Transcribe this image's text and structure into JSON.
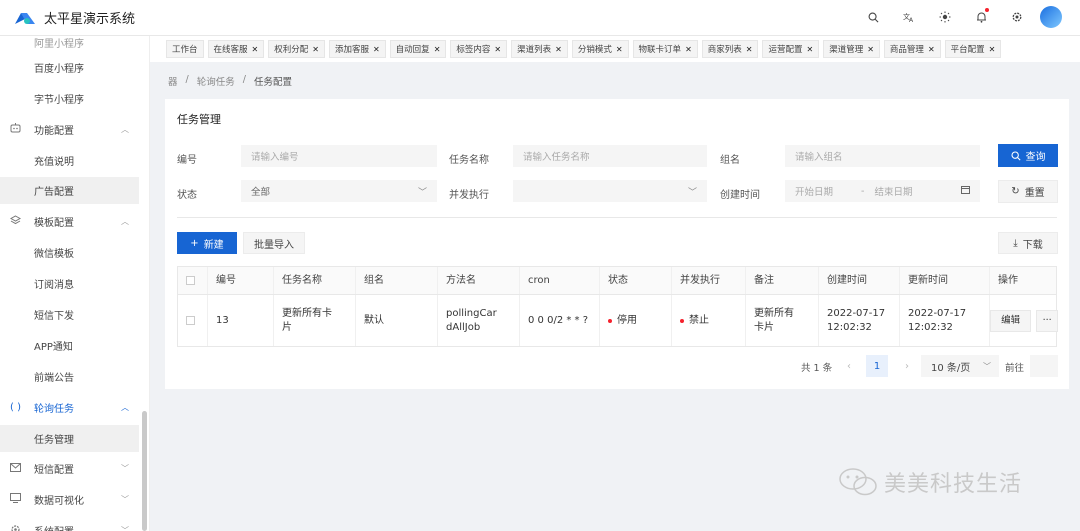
{
  "app": {
    "title": "太平星演示系统",
    "brand_color": "#1765d3"
  },
  "header": {
    "icons": [
      "search-icon",
      "translate-icon",
      "theme-sun-icon",
      "bell-icon",
      "settings-gear-icon",
      "avatar"
    ]
  },
  "sidebar": {
    "items": [
      {
        "label": "百度小程序",
        "type": "sub"
      },
      {
        "label": "字节小程序",
        "type": "sub"
      },
      {
        "label": "功能配置",
        "type": "group",
        "icon": "robot-icon"
      },
      {
        "label": "充值说明",
        "type": "sub"
      },
      {
        "label": "广告配置",
        "type": "sub",
        "active": true
      },
      {
        "label": "模板配置",
        "type": "group",
        "icon": "layers-icon"
      },
      {
        "label": "微信模板",
        "type": "sub"
      },
      {
        "label": "订阅消息",
        "type": "sub"
      },
      {
        "label": "短信下发",
        "type": "sub"
      },
      {
        "label": "APP通知",
        "type": "sub"
      },
      {
        "label": "前端公告",
        "type": "sub"
      },
      {
        "label": "轮询任务",
        "type": "group",
        "icon": "code-braces-icon",
        "open": true
      },
      {
        "label": "任务管理",
        "type": "sub",
        "active": true
      },
      {
        "label": "短信配置",
        "type": "group",
        "icon": "mail-icon"
      },
      {
        "label": "数据可视化",
        "type": "group",
        "icon": "monitor-icon"
      },
      {
        "label": "系统配置",
        "type": "group",
        "icon": "gear-icon"
      }
    ]
  },
  "tabs": [
    "工作台",
    "在线客服",
    "权利分配",
    "添加客服",
    "自动回复",
    "标签内容",
    "渠道列表",
    "分销模式",
    "物联卡订单",
    "商家列表",
    "运营配置",
    "渠道管理",
    "商品管理",
    "平台配置"
  ],
  "breadcrumb": {
    "home": "器",
    "parent": "轮询任务",
    "current": "任务配置"
  },
  "card": {
    "title": "任务管理"
  },
  "filters": {
    "id_label": "编号",
    "id_placeholder": "请输入编号",
    "name_label": "任务名称",
    "name_placeholder": "请输入任务名称",
    "group_label": "组名",
    "group_placeholder": "请输入组名",
    "status_label": "状态",
    "status_value": "全部",
    "concurrent_label": "并发执行",
    "concurrent_value": "",
    "created_label": "创建时间",
    "start_placeholder": "开始日期",
    "sep": "-",
    "end_placeholder": "结束日期",
    "search_button": "查询",
    "reset_button": "重置"
  },
  "toolbar": {
    "new_button": "新建",
    "import_button": "批量导入",
    "download_button": "下载"
  },
  "table": {
    "columns": [
      "编号",
      "任务名称",
      "组名",
      "方法名",
      "cron",
      "状态",
      "并发执行",
      "备注",
      "创建时间",
      "更新时间",
      "操作"
    ],
    "rows": [
      {
        "id": "13",
        "name": "更新所有卡片",
        "group": "默认",
        "method": "pollingCardAllJob",
        "cron": "0 0 0/2 * * ?",
        "status": "停用",
        "concurrent": "禁止",
        "remark": "更新所有卡片",
        "created_date": "2022-07-17",
        "created_time": "12:02:32",
        "updated_date": "2022-07-17",
        "updated_time": "12:02:32",
        "edit": "编辑",
        "more": "···"
      }
    ]
  },
  "pagination": {
    "total": "共 1 条",
    "page": "1",
    "page_size": "10 条/页",
    "goto": "前往"
  },
  "watermark": {
    "text": "美美科技生活"
  }
}
